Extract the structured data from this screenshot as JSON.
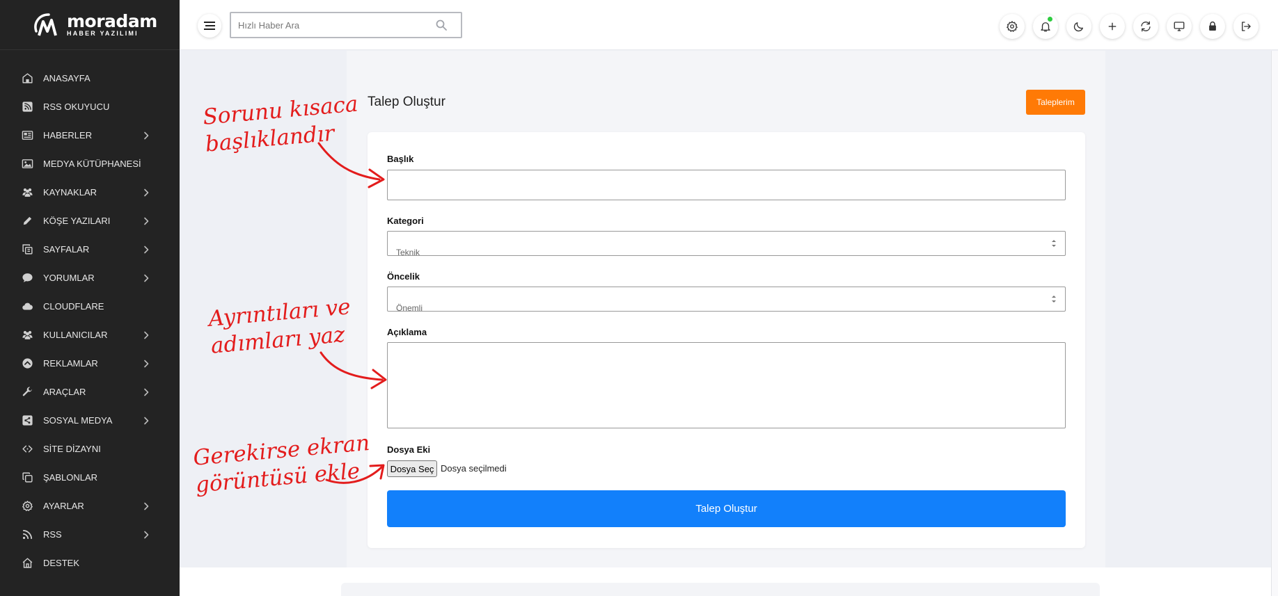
{
  "brand": {
    "name": "moradam",
    "subtitle": "HABER YAZILIMI"
  },
  "sidebar": {
    "items": [
      {
        "label": "ANASAYFA",
        "icon": "home-icon",
        "has_submenu": false
      },
      {
        "label": "RSS OKUYUCU",
        "icon": "rss-square-icon",
        "has_submenu": false
      },
      {
        "label": "HABERLER",
        "icon": "newspaper-icon",
        "has_submenu": true
      },
      {
        "label": "MEDYA KÜTÜPHANESİ",
        "icon": "image-icon",
        "has_submenu": false
      },
      {
        "label": "KAYNAKLAR",
        "icon": "users-icon",
        "has_submenu": true
      },
      {
        "label": "KÖŞE YAZILARI",
        "icon": "pencil-icon",
        "has_submenu": true
      },
      {
        "label": "SAYFALAR",
        "icon": "copy-icon",
        "has_submenu": true
      },
      {
        "label": "YORUMLAR",
        "icon": "comment-icon",
        "has_submenu": true
      },
      {
        "label": "CLOUDFLARE",
        "icon": "cloud-icon",
        "has_submenu": false
      },
      {
        "label": "KULLANICILAR",
        "icon": "users-icon",
        "has_submenu": true
      },
      {
        "label": "REKLAMLAR",
        "icon": "ad-circle-icon",
        "has_submenu": true
      },
      {
        "label": "ARAÇLAR",
        "icon": "wrench-icon",
        "has_submenu": true
      },
      {
        "label": "SOSYAL MEDYA",
        "icon": "share-icon",
        "has_submenu": true
      },
      {
        "label": "SİTE DİZAYNI",
        "icon": "code-icon",
        "has_submenu": false
      },
      {
        "label": "ŞABLONLAR",
        "icon": "clone-icon",
        "has_submenu": false
      },
      {
        "label": "AYARLAR",
        "icon": "gear-icon",
        "has_submenu": true
      },
      {
        "label": "RSS",
        "icon": "rss-icon",
        "has_submenu": true
      },
      {
        "label": "DESTEK",
        "icon": "home-outline-icon",
        "has_submenu": false
      }
    ]
  },
  "topbar": {
    "search_placeholder": "Hızlı Haber Ara",
    "icons": [
      "settings-icon",
      "bell-icon",
      "moon-icon",
      "plus-icon",
      "refresh-icon",
      "monitor-icon",
      "lock-icon",
      "logout-icon"
    ]
  },
  "main": {
    "title": "Talep Oluştur",
    "requests_button": "Taleplerim",
    "form": {
      "title_label": "Başlık",
      "title_value": "",
      "category_label": "Kategori",
      "category_value": "Teknik",
      "priority_label": "Öncelik",
      "priority_value": "Önemli",
      "description_label": "Açıklama",
      "description_value": "",
      "attachment_label": "Dosya Eki",
      "file_button": "Dosya Seç",
      "file_status": "Dosya seçilmedi",
      "submit_label": "Talep Oluştur"
    }
  },
  "annotations": {
    "title_hint": [
      "Sorunu kısaca",
      "başlıklandır"
    ],
    "description_hint": [
      "Ayrıntıları ve",
      "adımları yaz"
    ],
    "attachment_hint": [
      "Gerekirse ekran",
      "görüntüsü ekle"
    ]
  },
  "colors": {
    "sidebar_bg": "#232323",
    "accent_orange": "#ff7a06",
    "primary_blue": "#1280fb",
    "annotation_red": "#e31c1c",
    "notification_dot": "#2ecc40"
  }
}
